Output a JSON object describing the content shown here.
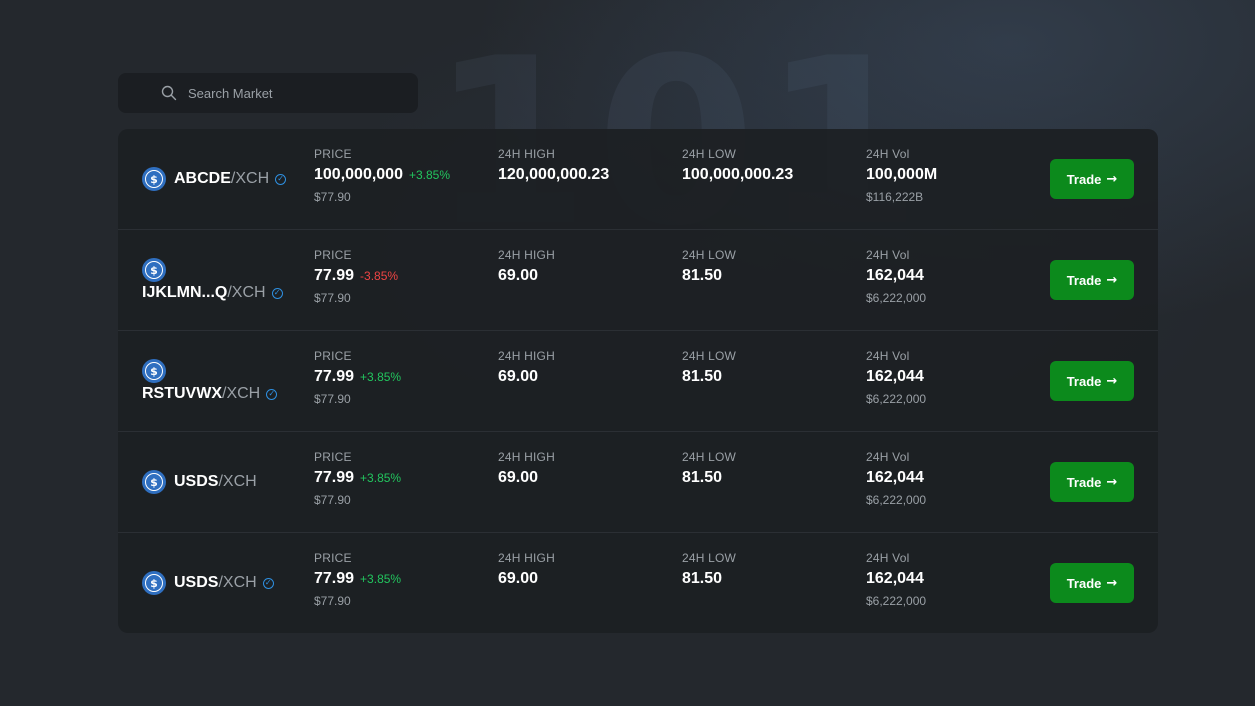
{
  "search": {
    "placeholder": "Search Market"
  },
  "labels": {
    "price": "PRICE",
    "high": "24H HIGH",
    "low": "24H LOW",
    "vol": "24H Vol",
    "trade": "Trade",
    "arrow": "→"
  },
  "colors": {
    "positive": "#22c55e",
    "negative": "#ef4444",
    "trade_button": "#0c8a1c",
    "verified": "#2e8fe0",
    "coin": "#2f6fc0"
  },
  "icons": {
    "search": "search-icon",
    "coin": "usd-coin-icon",
    "verified": "verified-check-icon",
    "trade_arrow": "arrow-right-icon"
  },
  "markets": [
    {
      "base": "ABCDE",
      "quote": "/XCH",
      "verified": true,
      "price": "100,000,000",
      "change": "+3.85%",
      "change_dir": "up",
      "price_usd": "$77.90",
      "high": "120,000,000.23",
      "low": "100,000,000.23",
      "vol": "100,000M",
      "vol_usd": "$116,222B"
    },
    {
      "base": "IJKLMN...Q",
      "quote": "/XCH",
      "verified": true,
      "price": "77.99",
      "change": "-3.85%",
      "change_dir": "down",
      "price_usd": "$77.90",
      "high": "69.00",
      "low": "81.50",
      "vol": "162,044",
      "vol_usd": "$6,222,000"
    },
    {
      "base": "RSTUVWX",
      "quote": "/XCH",
      "verified": true,
      "price": "77.99",
      "change": "+3.85%",
      "change_dir": "up",
      "price_usd": "$77.90",
      "high": "69.00",
      "low": "81.50",
      "vol": "162,044",
      "vol_usd": "$6,222,000"
    },
    {
      "base": "USDS",
      "quote": "/XCH",
      "verified": false,
      "price": "77.99",
      "change": "+3.85%",
      "change_dir": "up",
      "price_usd": "$77.90",
      "high": "69.00",
      "low": "81.50",
      "vol": "162,044",
      "vol_usd": "$6,222,000"
    },
    {
      "base": "USDS",
      "quote": "/XCH",
      "verified": true,
      "price": "77.99",
      "change": "+3.85%",
      "change_dir": "up",
      "price_usd": "$77.90",
      "high": "69.00",
      "low": "81.50",
      "vol": "162,044",
      "vol_usd": "$6,222,000"
    }
  ]
}
